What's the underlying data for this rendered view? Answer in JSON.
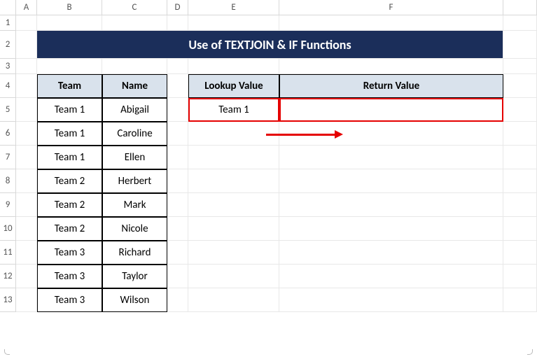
{
  "columns": [
    "A",
    "B",
    "C",
    "D",
    "E",
    "F"
  ],
  "rows": [
    "1",
    "2",
    "3",
    "4",
    "5",
    "6",
    "7",
    "8",
    "9",
    "10",
    "11",
    "12",
    "13"
  ],
  "title": "Use of TEXTJOIN & IF Functions",
  "table1": {
    "headers": {
      "team": "Team",
      "name": "Name"
    },
    "rows": [
      {
        "team": "Team 1",
        "name": "Abigail"
      },
      {
        "team": "Team 1",
        "name": "Caroline"
      },
      {
        "team": "Team 1",
        "name": "Ellen"
      },
      {
        "team": "Team 2",
        "name": "Herbert"
      },
      {
        "team": "Team 2",
        "name": "Mark"
      },
      {
        "team": "Team 2",
        "name": "Nicole"
      },
      {
        "team": "Team 3",
        "name": "Richard"
      },
      {
        "team": "Team 3",
        "name": "Taylor"
      },
      {
        "team": "Team 3",
        "name": "Wilson"
      }
    ]
  },
  "table2": {
    "headers": {
      "lookup": "Lookup Value",
      "return": "Return Value"
    },
    "lookup_value": "Team 1",
    "return_value": ""
  }
}
